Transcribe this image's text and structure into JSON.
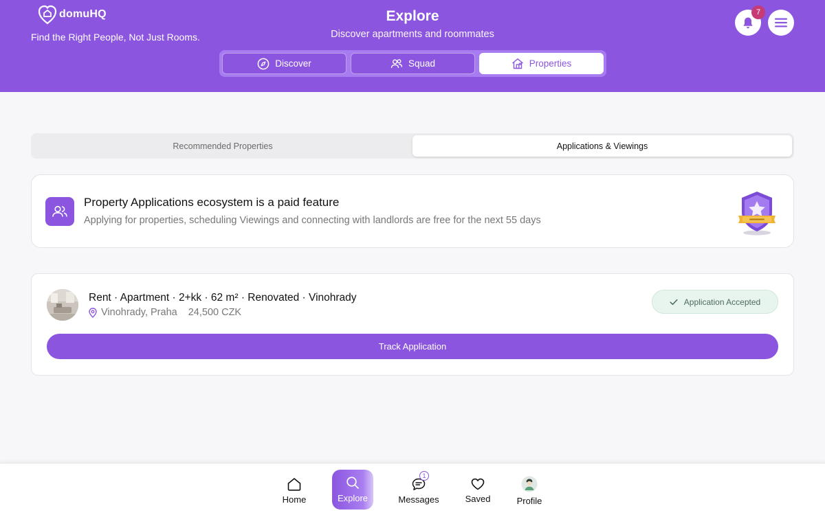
{
  "app": {
    "brand": "domuHQ",
    "tagline": "Find the Right People, Not Just Rooms.",
    "title": "Explore",
    "subtitle": "Discover apartments and roommates",
    "notification_count": "7",
    "accent_color": "#8b55e0"
  },
  "nav_tabs": [
    {
      "label": "Discover",
      "icon": "compass-icon",
      "active": false
    },
    {
      "label": "Squad",
      "icon": "people-icon",
      "active": false
    },
    {
      "label": "Properties",
      "icon": "house-icon",
      "active": true
    }
  ],
  "segments": [
    {
      "label": "Recommended Properties",
      "active": false
    },
    {
      "label": "Applications & Viewings",
      "active": true
    }
  ],
  "feature": {
    "title": "Property Applications ecosystem is a paid feature",
    "description": "Applying for properties, scheduling Viewings and connecting with landlords are free for the next 55 days",
    "icon": "users-icon",
    "badge_icon": "premium-shield-badge-icon"
  },
  "application": {
    "title": "Rent · Apartment · 2+kk · 62 m² · Renovated · Vinohrady",
    "location": "Vinohrady, Praha",
    "price": "24,500 CZK",
    "status": "Application Accepted",
    "status_color": "#e8f5ee",
    "action_label": "Track Application"
  },
  "bottom_nav": [
    {
      "label": "Home",
      "icon": "home-icon",
      "active": false
    },
    {
      "label": "Explore",
      "icon": "search-icon",
      "active": true
    },
    {
      "label": "Messages",
      "icon": "chat-icon",
      "active": false,
      "badge": "1"
    },
    {
      "label": "Saved",
      "icon": "heart-icon",
      "active": false
    },
    {
      "label": "Profile",
      "icon": "avatar-icon",
      "active": false
    }
  ]
}
